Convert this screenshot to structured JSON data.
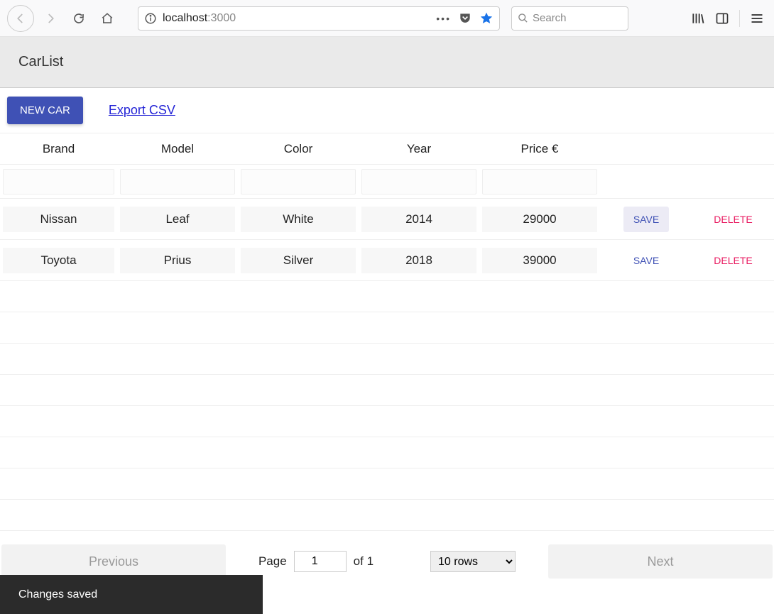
{
  "browser": {
    "url_host": "localhost",
    "url_port": ":3000",
    "search_placeholder": "Search"
  },
  "header": {
    "title": "CarList"
  },
  "toolbar": {
    "new_car_label": "NEW CAR",
    "export_label": "Export CSV"
  },
  "table": {
    "columns": [
      "Brand",
      "Model",
      "Color",
      "Year",
      "Price €"
    ],
    "rows": [
      {
        "brand": "Nissan",
        "model": "Leaf",
        "color": "White",
        "year": "2014",
        "price": "29000",
        "save": "SAVE",
        "delete": "DELETE"
      },
      {
        "brand": "Toyota",
        "model": "Prius",
        "color": "Silver",
        "year": "2018",
        "price": "39000",
        "save": "SAVE",
        "delete": "DELETE"
      }
    ]
  },
  "pagination": {
    "previous": "Previous",
    "next": "Next",
    "page_label": "Page",
    "page_current": "1",
    "of_label": "of 1",
    "rows_label": "10 rows"
  },
  "toast": {
    "message": "Changes saved"
  }
}
